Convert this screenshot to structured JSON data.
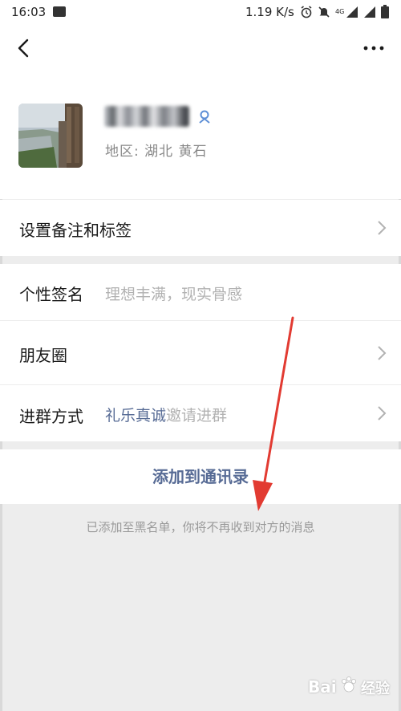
{
  "status_bar": {
    "time": "16:03",
    "network_speed": "1.19 K/s",
    "network_type": "4G",
    "icons": [
      "image-icon",
      "alarm-icon",
      "mute-icon",
      "signal-icon",
      "signal-icon",
      "battery-icon"
    ]
  },
  "header": {
    "back_icon": "chevron-left-icon",
    "more_icon": "more-dots-icon"
  },
  "profile": {
    "nickname": "",
    "gender_icon": "gender-icon",
    "region": "地区: 湖北  黄石"
  },
  "rows": {
    "remark_tags": {
      "label": "设置备注和标签"
    },
    "signature": {
      "label": "个性签名",
      "value": "理想丰满，现实骨感"
    },
    "moments": {
      "label": "朋友圈"
    },
    "join_group": {
      "label": "进群方式",
      "inviter": "礼乐真诚",
      "method": "邀请进群"
    }
  },
  "add_to_contacts": "添加到通讯录",
  "blacklist_note": "已添加至黑名单，你将不再收到对方的消息",
  "watermark": {
    "text": "Bai",
    "suffix": "经验"
  },
  "colors": {
    "link_blue": "#576b95",
    "annotation_red": "#e23b32",
    "background": "#ededed"
  }
}
